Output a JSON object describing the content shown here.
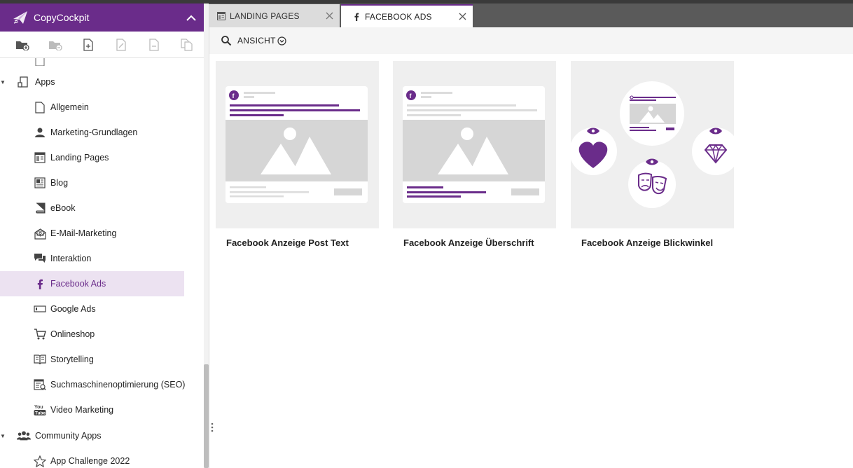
{
  "app": {
    "name": "CopyCockpit",
    "colors": {
      "brand": "#6a2c8a",
      "active_bg": "#ece2f1"
    }
  },
  "toolbar": {
    "icons": [
      "new-folder-icon",
      "delete-folder-icon",
      "new-document-icon",
      "copy-document-icon",
      "remove-document-icon",
      "duplicate-document-icon"
    ]
  },
  "tree": {
    "apps_label": "Apps",
    "items": [
      {
        "label": "Allgemein",
        "icon": "document-icon"
      },
      {
        "label": "Marketing-Grundlagen",
        "icon": "person-icon"
      },
      {
        "label": "Landing Pages",
        "icon": "landing-page-icon"
      },
      {
        "label": "Blog",
        "icon": "blog-icon"
      },
      {
        "label": "eBook",
        "icon": "ebook-icon"
      },
      {
        "label": "E-Mail-Marketing",
        "icon": "email-icon"
      },
      {
        "label": "Interaktion",
        "icon": "chat-icon"
      },
      {
        "label": "Facebook Ads",
        "icon": "facebook-icon"
      },
      {
        "label": "Google Ads",
        "icon": "ad-banner-icon"
      },
      {
        "label": "Onlineshop",
        "icon": "cart-icon"
      },
      {
        "label": "Storytelling",
        "icon": "open-book-icon"
      },
      {
        "label": "Suchmaschinenoptimierung (SEO)",
        "icon": "seo-icon"
      },
      {
        "label": "Video Marketing",
        "icon": "youtube-icon"
      }
    ],
    "community_label": "Community Apps",
    "community_items": [
      {
        "label": "App Challenge 2022",
        "icon": "star-icon"
      }
    ]
  },
  "tabs": [
    {
      "label": "LANDING PAGES",
      "icon": "landing-page-icon"
    },
    {
      "label": "FACEBOOK ADS",
      "icon": "facebook-icon"
    }
  ],
  "content": {
    "view_label": "ANSICHT",
    "cards": [
      {
        "title": "Facebook Anzeige Post Text"
      },
      {
        "title": "Facebook Anzeige Überschrift"
      },
      {
        "title": "Facebook Anzeige Blickwinkel"
      }
    ]
  }
}
